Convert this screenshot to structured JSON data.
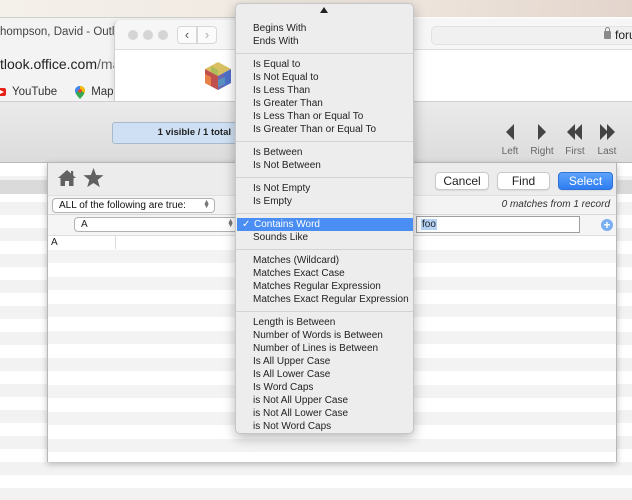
{
  "browser_back": {
    "tab_title": "hompson, David - Outlo",
    "tab_close": "×",
    "url_main": "tlook.office.com",
    "url_rest": "/mail/",
    "bookmarks": [
      {
        "icon": "youtube-icon",
        "label": "YouTube"
      },
      {
        "icon": "maps-icon",
        "label": "Maps"
      }
    ]
  },
  "browser_front": {
    "back_glyph": "‹",
    "forward_glyph": "›",
    "address_host": "foru",
    "favicon": "colorful-cube-icon"
  },
  "toolbar": {
    "found_set": "1 visible / 1 total",
    "nav": [
      {
        "name": "left",
        "label": "Left"
      },
      {
        "name": "right",
        "label": "Right"
      },
      {
        "name": "first",
        "label": "First"
      },
      {
        "name": "last",
        "label": "Last"
      }
    ]
  },
  "find_sheet": {
    "cancel_label": "Cancel",
    "find_label": "Find",
    "select_label": "Select",
    "match_mode": "ALL of the following are true:",
    "match_count": "0 matches from 1 record",
    "criteria": [
      {
        "field": "A",
        "operator": "Contains Word",
        "value": "foo"
      }
    ],
    "results": [
      {
        "A": "A"
      }
    ],
    "accent_color": "#3a86f5"
  },
  "operator_menu": {
    "selected": "Contains Word",
    "groups": [
      [
        "Begins With",
        "Ends With"
      ],
      [
        "Is Equal to",
        "Is Not Equal to",
        "Is Less Than",
        "Is Greater Than",
        "Is Less Than or Equal To",
        "Is Greater Than or Equal To"
      ],
      [
        "Is Between",
        "Is Not Between"
      ],
      [
        "Is Not Empty",
        "Is Empty"
      ],
      [
        "Contains Word",
        "Sounds Like"
      ],
      [
        "Matches (Wildcard)",
        "Matches Exact Case",
        "Matches Regular Expression",
        "Matches Exact Regular Expression"
      ],
      [
        "Length is Between",
        "Number of Words is Between",
        "Number of Lines is Between",
        "Is All Upper Case",
        "Is All Lower Case",
        "Is Word Caps",
        "is Not All Upper Case",
        "is Not All Lower Case",
        "is Not Word Caps"
      ]
    ],
    "check_glyph": "✓",
    "highlight_color": "#4a8df3"
  }
}
